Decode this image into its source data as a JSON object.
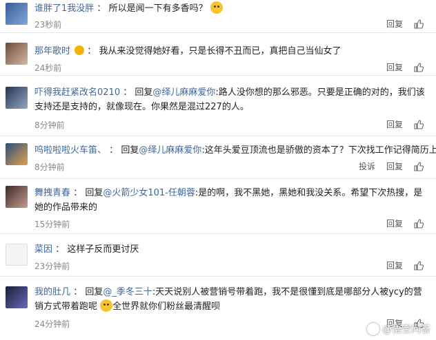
{
  "comments": [
    {
      "user": "谁胖了1我没胖",
      "text": "所以是闻一下有多香吗？",
      "time": "23秒前",
      "reply": "回复"
    },
    {
      "user": "那年歌时",
      "text": "我从来没觉得她好看，只是长得不丑而已，真把自己当仙女了",
      "time": "24秒前",
      "reply": "回复"
    },
    {
      "user": "吓得我赶紧改名0210",
      "prefix": "回复",
      "mention": "@绎儿麻麻爱你",
      "text": ":路人没你想的那么邪恶。只要是正确的对的，我们该支持还是支持的，就像现在。你果然是混过227的人。",
      "time": "8分钟前",
      "reply": "回复"
    },
    {
      "user": "呜啦啦啦火车笛、",
      "prefix": "回复",
      "mention": "@绎儿麻麻爱你",
      "text": ":这年头爱豆顶流也是骄傲的资本了？下次找工作记得简历上写上",
      "time": "8分钟前",
      "report": "投诉",
      "reply": "回复"
    },
    {
      "user": "舞拽青春",
      "prefix": "回复",
      "mention": "@火箭少女101-任朝蓉",
      "text": ":是的啊，我不黑她，黑她和我没关系。希望下次热搜，是她的作品带来的",
      "time": "15分钟前",
      "reply": "回复"
    },
    {
      "user": "菜因",
      "text": "这样子反而更讨厌",
      "time": "23分钟前",
      "reply": "回复"
    },
    {
      "user": "我的肚几",
      "prefix": "回复",
      "mention": "@_季冬三十",
      "text": ":天天说别人被营销号带着跑，我不是很懂到底是哪部分人被ycy的营销方式带着跑呢",
      "text2": "全世界就你们粉丝最清醒呗",
      "time": "24分钟前",
      "reply": "回复"
    }
  ],
  "sep": "：",
  "watermark": "@悟空问答",
  "colors": {
    "link": "#406599",
    "time": "#888888",
    "border": "#e6e6e6"
  },
  "icons": {
    "like": "thumbs-up-icon",
    "emoji": "grin-emoji-icon",
    "badge": "crown-badge-icon"
  }
}
